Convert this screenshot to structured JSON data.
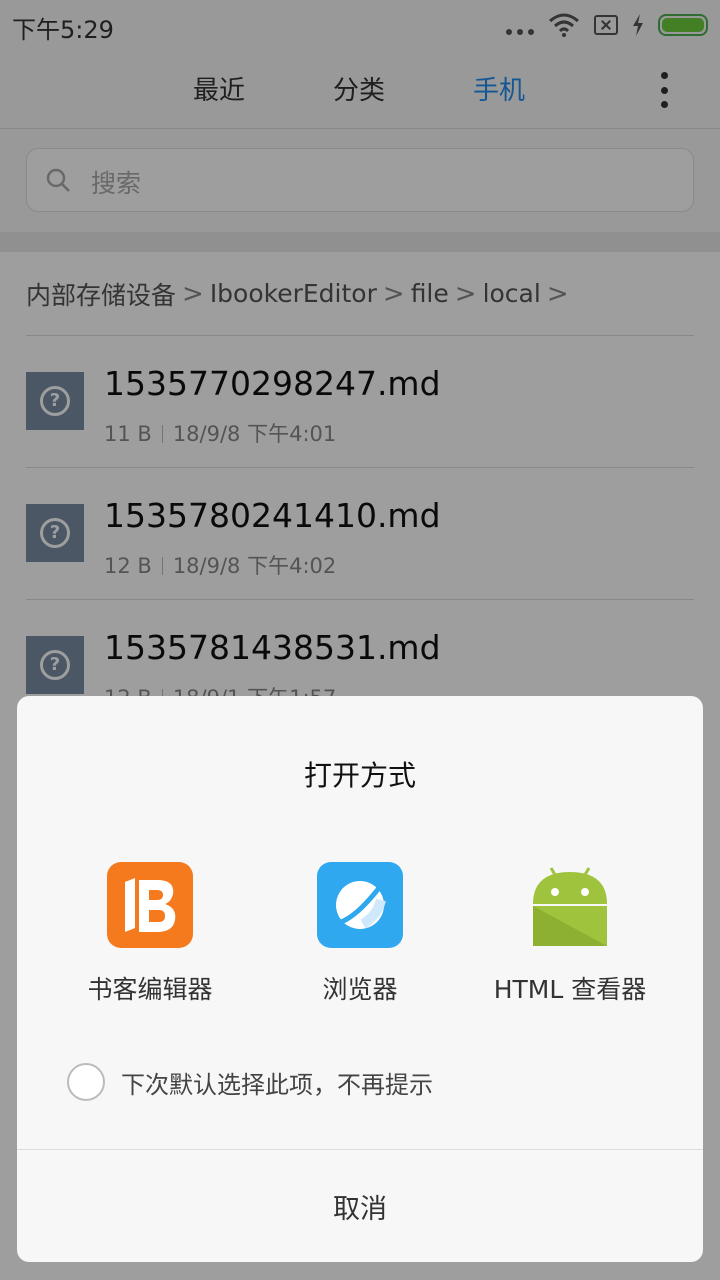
{
  "status_bar": {
    "time": "下午5:29",
    "icons": [
      "more-dots-icon",
      "wifi-icon",
      "no-sim-icon",
      "charging-icon",
      "battery-icon"
    ],
    "battery_color": "#6ccf3c"
  },
  "header": {
    "tabs": [
      {
        "label": "最近",
        "active": false
      },
      {
        "label": "分类",
        "active": false
      },
      {
        "label": "手机",
        "active": true
      }
    ],
    "accent_color": "#1f8ef1"
  },
  "search": {
    "placeholder": "搜索"
  },
  "breadcrumb": [
    "内部存储设备",
    "IbookerEditor",
    "file",
    "local"
  ],
  "files": [
    {
      "name": "1535770298247.md",
      "size": "11 B",
      "date": "18/9/8 下午4:01"
    },
    {
      "name": "1535780241410.md",
      "size": "12 B",
      "date": "18/9/8 下午4:02"
    },
    {
      "name": "1535781438531.md",
      "size": "12 B",
      "date": "18/9/1 下午1:57"
    }
  ],
  "dialog": {
    "title": "打开方式",
    "apps": [
      {
        "label": "书客编辑器",
        "icon": "book-editor-icon",
        "color": "#f57a1e"
      },
      {
        "label": "浏览器",
        "icon": "browser-icon",
        "color": "#2fa8ef"
      },
      {
        "label": "HTML 查看器",
        "icon": "android-icon",
        "color": "#9fc33c"
      }
    ],
    "default_label": "下次默认选择此项，不再提示",
    "cancel_label": "取消"
  }
}
